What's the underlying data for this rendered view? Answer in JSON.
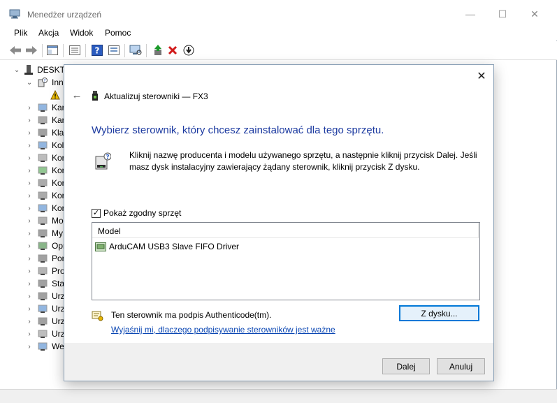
{
  "window": {
    "title": "Menedżer urządzeń",
    "controls": {
      "minimize": "—",
      "maximize": "☐",
      "close": "✕"
    }
  },
  "menu": [
    "Plik",
    "Akcja",
    "Widok",
    "Pomoc"
  ],
  "toolbar": {
    "icons": [
      "back-arrow-icon",
      "forward-arrow-icon",
      "properties-panel-icon",
      "details-icon",
      "help-icon",
      "list-icon",
      "scan-monitor-icon",
      "update-driver-icon",
      "uninstall-x-icon",
      "download-icon"
    ],
    "uninstall_color": "#d11a1a"
  },
  "tree": {
    "root": "DESKTO",
    "items": [
      {
        "label": "Inn",
        "expanded": true,
        "icon": "unknown-device-icon"
      },
      {
        "label": "",
        "child": true,
        "icon": "warning-device-icon"
      },
      {
        "label": "Kar",
        "icon": "network-card-icon"
      },
      {
        "label": "Kar",
        "icon": "display-card-icon"
      },
      {
        "label": "Klav",
        "icon": "keyboard-icon"
      },
      {
        "label": "Kol",
        "icon": "controller-icon"
      },
      {
        "label": "Kor",
        "icon": "monitor-icon"
      },
      {
        "label": "Kor",
        "icon": "audio-icon"
      },
      {
        "label": "Kor",
        "icon": "network-icon"
      },
      {
        "label": "Kor",
        "icon": "storage-icon"
      },
      {
        "label": "Kor",
        "icon": "usb-icon"
      },
      {
        "label": "Mo",
        "icon": "monitor-icon"
      },
      {
        "label": "My",
        "icon": "mouse-icon"
      },
      {
        "label": "Opr",
        "icon": "firmware-icon"
      },
      {
        "label": "Por",
        "icon": "port-icon"
      },
      {
        "label": "Pro",
        "icon": "processor-icon"
      },
      {
        "label": "Sta",
        "icon": "disk-icon"
      },
      {
        "label": "Urz",
        "icon": "system-device-icon"
      },
      {
        "label": "Urz",
        "icon": "usb-device-icon"
      },
      {
        "label": "Urz",
        "icon": "hid-icon"
      },
      {
        "label": "Urz",
        "icon": "software-device-icon"
      },
      {
        "label": "Wej",
        "icon": "speaker-icon"
      }
    ]
  },
  "dialog": {
    "close": "✕",
    "back": "←",
    "header_title": "Aktualizuj sterowniki — FX3",
    "heading": "Wybierz sterownik, który chcesz zainstalować dla tego sprzętu.",
    "description": "Kliknij nazwę producenta i modelu używanego sprzętu, a następnie kliknij przycisk Dalej. Jeśli masz dysk instalacyjny zawierający żądany sterownik, kliknij przycisk Z dysku.",
    "checkbox_label": "Pokaż zgodny sprzęt",
    "checkbox_checked": true,
    "checkbox_mark": "✓",
    "list_header": "Model",
    "list_items": [
      "ArduCAM USB3 Slave FIFO Driver"
    ],
    "signature_text": "Ten sterownik ma podpis Authenticode(tm).",
    "signature_link": "Wyjaśnij mi, dlaczego podpisywanie sterowników jest ważne",
    "disk_button": "Z dysku...",
    "next_button": "Dalej",
    "cancel_button": "Anuluj",
    "heading_color": "#1c3aa0",
    "link_color": "#0a46b3"
  }
}
